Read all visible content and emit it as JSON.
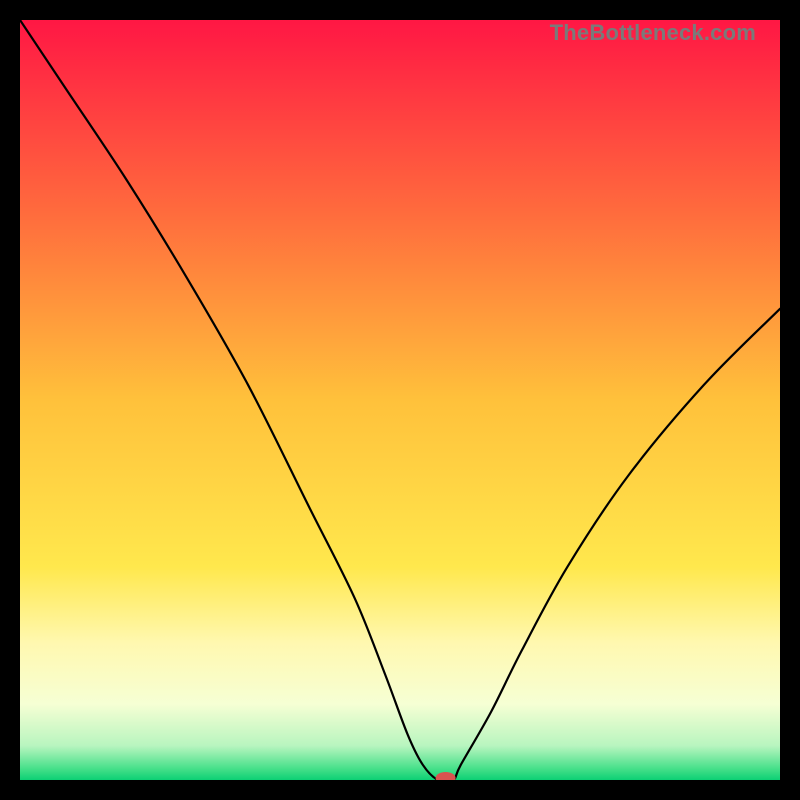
{
  "watermark": "TheBottleneck.com",
  "chart_data": {
    "type": "line",
    "title": "",
    "xlabel": "",
    "ylabel": "",
    "xlim": [
      0,
      100
    ],
    "ylim": [
      0,
      100
    ],
    "series": [
      {
        "name": "bottleneck-curve",
        "x": [
          0,
          6,
          14,
          22,
          30,
          38,
          44,
          48,
          51,
          53,
          55,
          57,
          58,
          62,
          66,
          72,
          80,
          90,
          100
        ],
        "values": [
          100,
          91,
          79,
          66,
          52,
          36,
          24,
          14,
          6,
          2,
          0,
          0,
          2,
          9,
          17,
          28,
          40,
          52,
          62
        ]
      }
    ],
    "annotations": [
      {
        "name": "min-marker",
        "x": 56,
        "y": 0,
        "color": "#d9534f"
      }
    ],
    "background_gradient": {
      "stops": [
        {
          "offset": 0.0,
          "color": "#ff1744"
        },
        {
          "offset": 0.25,
          "color": "#ff6a3d"
        },
        {
          "offset": 0.5,
          "color": "#ffc13b"
        },
        {
          "offset": 0.72,
          "color": "#ffe84d"
        },
        {
          "offset": 0.82,
          "color": "#fff8b0"
        },
        {
          "offset": 0.9,
          "color": "#f6ffd4"
        },
        {
          "offset": 0.955,
          "color": "#b8f5bf"
        },
        {
          "offset": 0.985,
          "color": "#47e08a"
        },
        {
          "offset": 1.0,
          "color": "#0cd074"
        }
      ]
    },
    "curve_color": "#000000",
    "curve_width": 2.2,
    "marker_rx": 10,
    "marker_ry": 6
  }
}
